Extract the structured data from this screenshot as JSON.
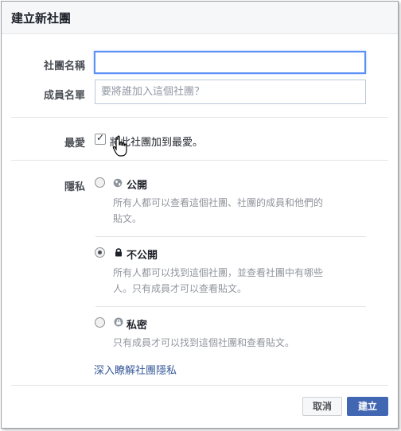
{
  "dialog": {
    "title": "建立新社團"
  },
  "form": {
    "name_label": "社團名稱",
    "name_value": "",
    "members_label": "成員名單",
    "members_placeholder": "要將誰加入這個社團？",
    "favorite_label": "最愛",
    "favorite_text": "將此社團加到最愛。",
    "favorite_checked": true,
    "privacy_label": "隱私",
    "privacy_options": [
      {
        "title": "公開",
        "icon": "globe-icon",
        "selected": false,
        "desc": [
          "所有人都可以查看這個社團、社團的成員和他們的",
          "貼文。"
        ]
      },
      {
        "title": "不公開",
        "icon": "lock-icon",
        "selected": true,
        "desc": [
          "所有人都可以找到這個社團，並查看社團中有哪些",
          "人。只有成員才可以查看貼文。"
        ]
      },
      {
        "title": "私密",
        "icon": "secret-lock-icon",
        "selected": false,
        "desc": [
          "只有成員才可以找到這個社團和查看貼文。"
        ]
      }
    ],
    "privacy_link": "深入瞭解社團隱私"
  },
  "footer": {
    "cancel_label": "取消",
    "create_label": "建立"
  },
  "colors": {
    "primary": "#4267b2",
    "link": "#365899",
    "focus": "#5b90f6"
  }
}
